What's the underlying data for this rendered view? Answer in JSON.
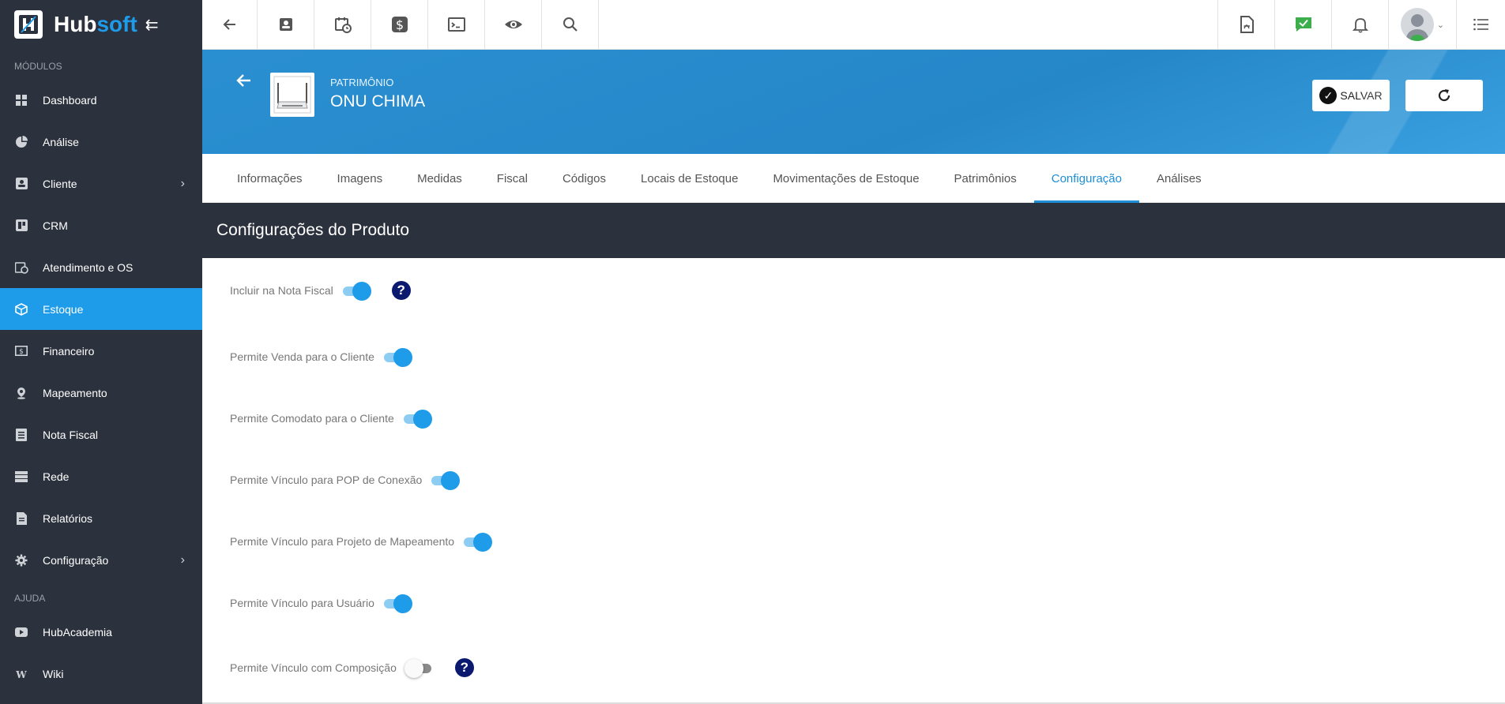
{
  "brand": {
    "name_part1": "Hub",
    "name_part2": "soft"
  },
  "sidebar": {
    "section_modules": "MÓDULOS",
    "section_help": "AJUDA",
    "items": [
      {
        "label": "Dashboard",
        "icon": "dashboard-icon"
      },
      {
        "label": "Análise",
        "icon": "pie-chart-icon"
      },
      {
        "label": "Cliente",
        "icon": "contact-card-icon",
        "chevron": true
      },
      {
        "label": "CRM",
        "icon": "crm-icon"
      },
      {
        "label": "Atendimento e OS",
        "icon": "calendar-clock-icon"
      },
      {
        "label": "Estoque",
        "icon": "box-icon",
        "active": true
      },
      {
        "label": "Financeiro",
        "icon": "money-icon"
      },
      {
        "label": "Mapeamento",
        "icon": "map-pin-icon"
      },
      {
        "label": "Nota Fiscal",
        "icon": "receipt-icon"
      },
      {
        "label": "Rede",
        "icon": "server-icon"
      },
      {
        "label": "Relatórios",
        "icon": "report-icon"
      },
      {
        "label": "Configuração",
        "icon": "gear-icon",
        "chevron": true
      }
    ],
    "help_items": [
      {
        "label": "HubAcademia",
        "icon": "video-icon"
      },
      {
        "label": "Wiki",
        "icon": "wiki-icon"
      }
    ]
  },
  "header": {
    "subtitle": "PATRIMÔNIO",
    "title": "ONU CHIMA",
    "save_label": "SALVAR"
  },
  "tabs": [
    {
      "label": "Informações"
    },
    {
      "label": "Imagens"
    },
    {
      "label": "Medidas"
    },
    {
      "label": "Fiscal"
    },
    {
      "label": "Códigos"
    },
    {
      "label": "Locais de Estoque"
    },
    {
      "label": "Movimentações de Estoque"
    },
    {
      "label": "Patrimônios"
    },
    {
      "label": "Configuração",
      "active": true
    },
    {
      "label": "Análises"
    }
  ],
  "section": {
    "title": "Configurações do Produto"
  },
  "settings": [
    {
      "label": "Incluir na Nota Fiscal",
      "on": true,
      "help": true
    },
    {
      "label": "Permite Venda para o Cliente",
      "on": true
    },
    {
      "label": "Permite Comodato para o Cliente",
      "on": true
    },
    {
      "label": "Permite Vínculo para POP de Conexão",
      "on": true
    },
    {
      "label": "Permite Vínculo para Projeto de Mapeamento",
      "on": true
    },
    {
      "label": "Permite Vínculo para Usuário",
      "on": true
    },
    {
      "label": "Permite Vínculo com Composição",
      "on": false,
      "help": true
    }
  ],
  "help_glyph": "?",
  "colors": {
    "accent": "#1e9be9",
    "sidebar": "#2c323d",
    "help": "#0b1a6e",
    "header": "#2587c8"
  }
}
